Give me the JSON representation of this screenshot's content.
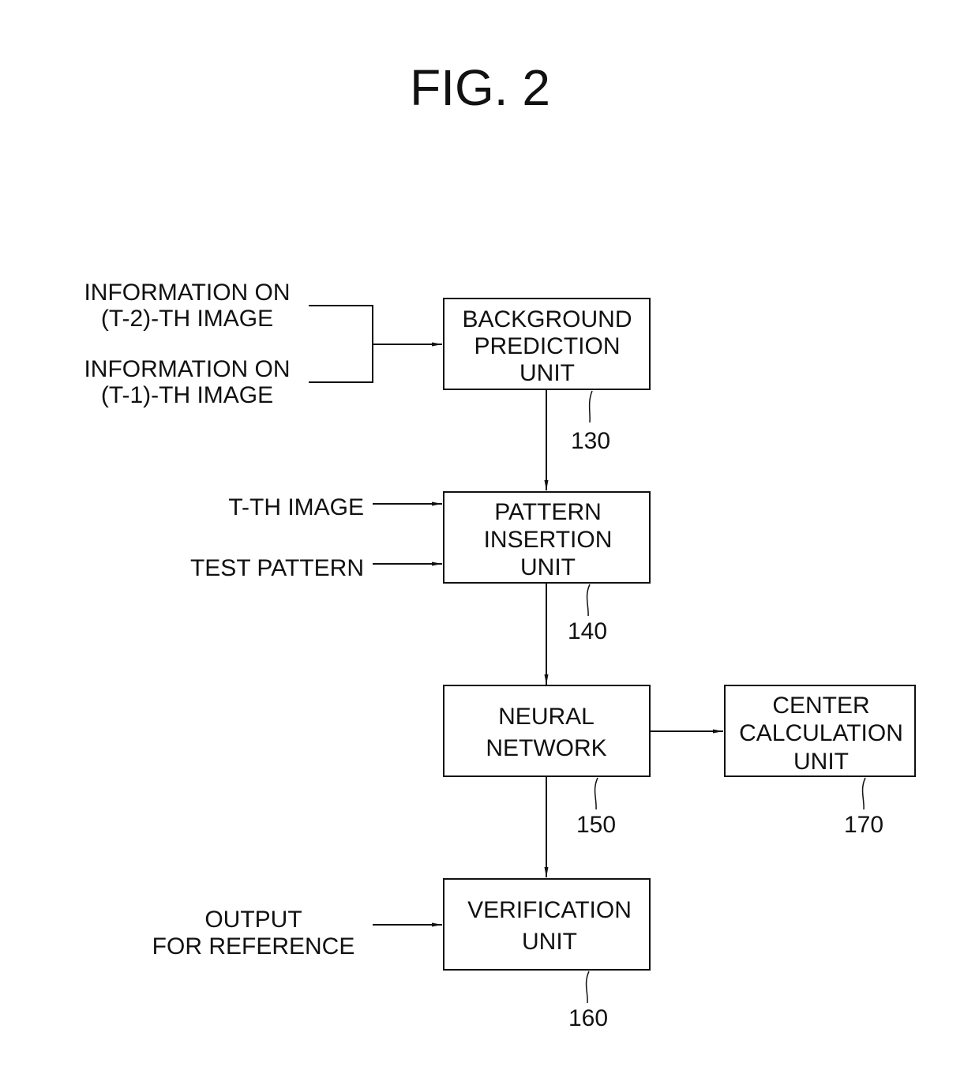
{
  "figure": {
    "title": "FIG. 2"
  },
  "inputs": {
    "t2_info": [
      "INFORMATION ON",
      "(T-2)-TH IMAGE"
    ],
    "t1_info": [
      "INFORMATION ON",
      "(T-1)-TH IMAGE"
    ],
    "t_image": "T-TH IMAGE",
    "test_pattern": "TEST PATTERN",
    "output_reference": [
      "OUTPUT",
      "FOR REFERENCE"
    ]
  },
  "blocks": {
    "background_prediction": {
      "lines": [
        "BACKGROUND",
        "PREDICTION",
        "UNIT"
      ],
      "ref": "130"
    },
    "pattern_insertion": {
      "lines": [
        "PATTERN",
        "INSERTION",
        "UNIT"
      ],
      "ref": "140"
    },
    "neural_network": {
      "lines": [
        "NEURAL",
        "NETWORK"
      ],
      "ref": "150"
    },
    "verification": {
      "lines": [
        "VERIFICATION",
        "UNIT"
      ],
      "ref": "160"
    },
    "center_calculation": {
      "lines": [
        "CENTER",
        "CALCULATION",
        "UNIT"
      ],
      "ref": "170"
    }
  },
  "edges": [
    {
      "from": "t2_info",
      "to": "background_prediction"
    },
    {
      "from": "t1_info",
      "to": "background_prediction"
    },
    {
      "from": "background_prediction",
      "to": "pattern_insertion"
    },
    {
      "from": "t_image",
      "to": "pattern_insertion"
    },
    {
      "from": "test_pattern",
      "to": "pattern_insertion"
    },
    {
      "from": "pattern_insertion",
      "to": "neural_network"
    },
    {
      "from": "neural_network",
      "to": "center_calculation"
    },
    {
      "from": "neural_network",
      "to": "verification"
    },
    {
      "from": "output_reference",
      "to": "verification"
    }
  ]
}
